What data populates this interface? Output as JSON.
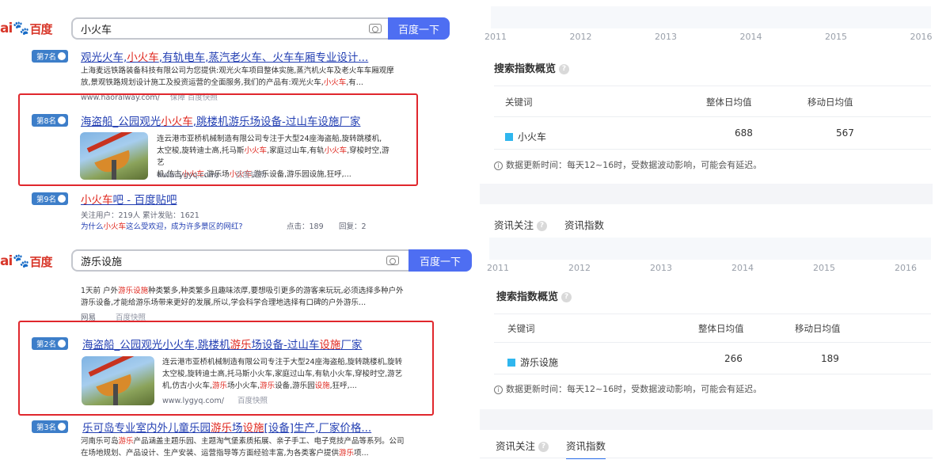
{
  "search1": {
    "logo": "百度",
    "logo_prefix": "ai",
    "query": "小火车",
    "button": "百度一下",
    "results": [
      {
        "rank": "第7名",
        "title_parts": [
          {
            "t": "观光火车,",
            "hl": false
          },
          {
            "t": "小火车",
            "hl": true
          },
          {
            "t": ",有轨电车,蒸汽老火车、火车车厢专业设计...",
            "hl": false
          }
        ],
        "snippet_line1": "上海麦远铁路装备科技有限公司为您提供:观光火车项目整体实施,蒸汽机火车及老火车车厢观摩",
        "snippet_line2_parts": [
          {
            "t": "放,景观铁路规划设计施工及投资运营的全面服务,我们的产品有:观光火车,",
            "hl": false
          },
          {
            "t": "小火车",
            "hl": true
          },
          {
            "t": ",有...",
            "hl": false
          }
        ],
        "url": "www.haoralway.com/",
        "url_tags": "保障   百度快照"
      },
      {
        "rank": "第8名",
        "title_parts": [
          {
            "t": "海盗船_公园观光",
            "hl": false
          },
          {
            "t": "小火车",
            "hl": true
          },
          {
            "t": ",跳楼机游乐场设备-过山车设施厂家",
            "hl": false
          }
        ],
        "snippet_lines": [
          [
            {
              "t": "连云港市亚桥机械制造有限公司专注于大型24座海盗船,旋转跳楼机,",
              "hl": false
            }
          ],
          [
            {
              "t": "太空梭,旋转迪士高,托马斯",
              "hl": false
            },
            {
              "t": "小火车",
              "hl": true
            },
            {
              "t": ",家庭过山车,有轨",
              "hl": false
            },
            {
              "t": "小火车",
              "hl": true
            },
            {
              "t": ",穿梭时空,游艺",
              "hl": false
            }
          ],
          [
            {
              "t": "机,仿古",
              "hl": false
            },
            {
              "t": "小火车",
              "hl": true
            },
            {
              "t": ",游乐场",
              "hl": false
            },
            {
              "t": "小火车",
              "hl": true
            },
            {
              "t": ",游乐设备,游乐园设施,狂呼,...",
              "hl": false
            }
          ]
        ],
        "url": "www.lygyq.com/",
        "url_tag": "百度快照"
      },
      {
        "rank": "第9名",
        "title_parts": [
          {
            "t": "小火车",
            "hl": true
          },
          {
            "t": "吧 - 百度贴吧",
            "hl": false
          }
        ],
        "meta_line": "关注用户：219人    累计发贴：1621",
        "sub_parts": [
          {
            "t": "为什么",
            "hl": false
          },
          {
            "t": "小火车",
            "hl": true
          },
          {
            "t": "这么受欢迎，成为许多景区的网红?",
            "hl": false
          }
        ],
        "clicks": "点击：189",
        "replies": "回复：2"
      }
    ]
  },
  "search2": {
    "logo": "百度",
    "logo_prefix": "ai",
    "query": "游乐设施",
    "button": "百度一下",
    "results": [
      {
        "snippet_line1_parts": [
          {
            "t": "1天前 户外",
            "hl": false
          },
          {
            "t": "游乐设施",
            "hl": true
          },
          {
            "t": "种类繁多,种类繁多且趣味浓厚,要想吸引更多的游客来玩玩,必须选择多种户外",
            "hl": false
          }
        ],
        "snippet_line2": "游乐设备,才能给游乐场带来更好的发展,所以,学会科学合理地选择有口碑的户外游乐...",
        "url": "网易",
        "url_tag": "百度快照"
      },
      {
        "rank": "第2名",
        "title_parts": [
          {
            "t": "海盗船_公园观光小火车,跳楼机",
            "hl": false
          },
          {
            "t": "游乐",
            "hl": true
          },
          {
            "t": "场设备-过山车",
            "hl": false
          },
          {
            "t": "设施",
            "hl": true
          },
          {
            "t": "厂家",
            "hl": false
          }
        ],
        "snippet_lines": [
          [
            {
              "t": "连云港市亚桥机械制造有限公司专注于大型24座海盗船,旋转跳楼机,旋转",
              "hl": false
            }
          ],
          [
            {
              "t": "太空梭,旋转迪士高,托马斯小火车,家庭过山车,有轨小火车,穿梭时空,游艺",
              "hl": false
            }
          ],
          [
            {
              "t": "机,仿古小火车,",
              "hl": false
            },
            {
              "t": "游乐",
              "hl": true
            },
            {
              "t": "场小火车,",
              "hl": false
            },
            {
              "t": "游乐",
              "hl": true
            },
            {
              "t": "设备,游乐园",
              "hl": false
            },
            {
              "t": "设施",
              "hl": true
            },
            {
              "t": ",狂呼,...",
              "hl": false
            }
          ]
        ],
        "url": "www.lygyq.com/",
        "url_tag": "百度快照"
      },
      {
        "rank": "第3名",
        "title_parts": [
          {
            "t": "乐可岛专业室内外儿童乐园",
            "hl": false
          },
          {
            "t": "游乐",
            "hl": true
          },
          {
            "t": "场",
            "hl": false
          },
          {
            "t": "设施",
            "hl": true
          },
          {
            "t": "[设备]生产,厂家价格...",
            "hl": false
          }
        ],
        "snippet_line1_parts": [
          {
            "t": "河南乐可岛",
            "hl": false
          },
          {
            "t": "游乐",
            "hl": true
          },
          {
            "t": "产品涵盖主题乐园、主题淘气堡素质拓展、亲子手工、电子竞技产品等系列。公司",
            "hl": false
          }
        ],
        "snippet_line2_parts": [
          {
            "t": "在场地规划、产品设计、生产安装、运营指导等方面经验丰富,为各类客户提供",
            "hl": false
          },
          {
            "t": "游乐",
            "hl": true
          },
          {
            "t": "项...",
            "hl": false
          }
        ]
      }
    ]
  },
  "index1": {
    "years": [
      "2011",
      "2012",
      "2013",
      "2014",
      "2015",
      "2016"
    ],
    "overview_title": "搜索指数概览",
    "col_keyword": "关键词",
    "col_overall": "整体日均值",
    "col_mobile": "移动日均值",
    "keyword": "小火车",
    "overall": "688",
    "mobile": "567",
    "series_color": "#2fb6ee",
    "note": "数据更新时间：每天12~16时，受数据波动影响，可能会有延迟。",
    "tab_news_attention": "资讯关注",
    "tab_news_index": "资讯指数"
  },
  "index2": {
    "years": [
      "2011",
      "2012",
      "2013",
      "2014",
      "2015",
      "2016"
    ],
    "overview_title": "搜索指数概览",
    "col_keyword": "关键词",
    "col_overall": "整体日均值",
    "col_mobile": "移动日均值",
    "keyword": "游乐设施",
    "overall": "266",
    "mobile": "189",
    "series_color": "#2fb6ee",
    "note": "数据更新时间：每天12~16时，受数据波动影响，可能会有延迟。",
    "tab_news_attention": "资讯关注",
    "tab_news_index": "资讯指数"
  }
}
